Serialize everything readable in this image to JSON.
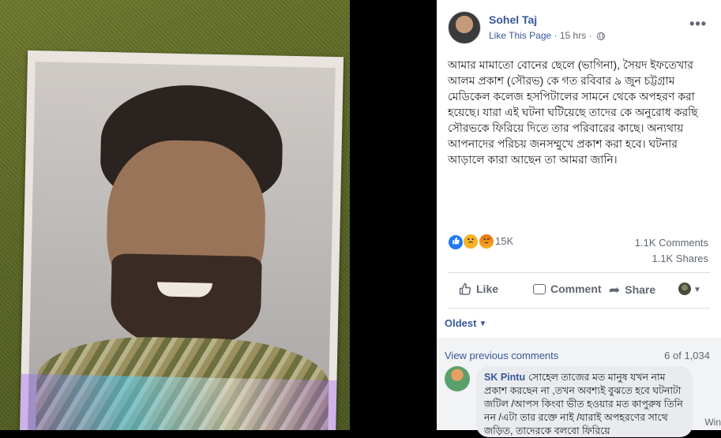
{
  "post": {
    "author": "Sohel Taj",
    "like_page": "Like This Page",
    "separator": " · ",
    "time": "15 hrs",
    "separator2": " · ",
    "text": "আমার মামাতো বোনের ছেলে (ভাগিনা), সৈয়দ ইফতেখার আলম প্রকাশ (সৌরভ) কে গত রবিবার ৯ জুন চট্টগ্রাম মেডিকেল কলেজ হসপিটালের সামনে থেকে অপহরণ করা হয়েছে। যারা এই ঘটনা ঘটিয়েছে তাদের কে অনুরোধ করছি সৌরভকে ফিরিয়ে দিতে তার পরিবারের কাছে। অন্যথায় আপনাদের পরিচয় জনসম্মুখে প্রকাশ করা হবে। ঘটনার আড়ালে কারা আছেন তা আমরা জানি।",
    "more_icon": "•••"
  },
  "stats": {
    "reactions_count": "15K",
    "comments": "1.1K Comments",
    "shares": "1.1K Shares",
    "reaction_icons": [
      "like-icon",
      "sad-icon",
      "angry-icon"
    ]
  },
  "actions": {
    "like": "Like",
    "comment": "Comment",
    "share": "Share"
  },
  "comments": {
    "sort": "Oldest",
    "view_previous": "View previous comments",
    "pager": "6 of 1,034",
    "items": [
      {
        "author": "SK Pintu",
        "text": "সোহেল তাজের মত মানুষ যখন নাম প্রকাশ করছেন না ,তখন অবশ্যই বুঝতে হবে ঘটনাটা জটিল /আপস কিংবা ভীত হওয়ার মত কাপুরুষ তিনি নন /এটা তার রক্তে নাই /যারাই অপহরণের সাথে জড়িত, তাদেরকে বলবো ফিরিয়ে"
      }
    ]
  },
  "watermark": "Win",
  "colors": {
    "fb_blue": "#385898",
    "gray_text": "#606770",
    "like_blue": "#2078f4"
  }
}
